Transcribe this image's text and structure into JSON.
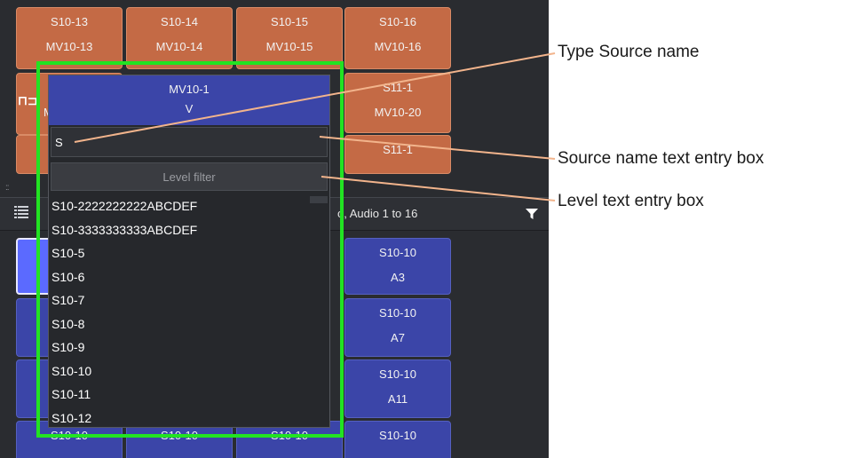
{
  "grid": {
    "top_row": [
      {
        "source": "S10-13",
        "name": "MV10-13"
      },
      {
        "source": "S10-14",
        "name": "MV10-14"
      },
      {
        "source": "S10-15",
        "name": "MV10-15"
      },
      {
        "source": "S10-16",
        "name": "MV10-16"
      }
    ],
    "right_column_top": [
      {
        "source": "S11-1",
        "name": "MV10-20"
      },
      {
        "source": "S11-1",
        "name": ""
      }
    ],
    "partial_left_label": "M",
    "level_bar_text": "o, Audio 1 to 16",
    "lower_right_column": [
      {
        "source": "S10-10",
        "level": "A3"
      },
      {
        "source": "S10-10",
        "level": "A7"
      },
      {
        "source": "S10-10",
        "level": "A11"
      },
      {
        "source": "S10-10",
        "level": ""
      }
    ],
    "bottom_partial_labels": [
      "S10-10",
      "S10-10",
      "S10-10"
    ]
  },
  "popup": {
    "header_line1": "MV10-1",
    "header_line2": "V",
    "source_value": "S",
    "level_placeholder": "Level filter",
    "results": [
      "S10-2222222222ABCDEF",
      "S10-3333333333ABCDEF",
      "S10-5",
      "S10-6",
      "S10-7",
      "S10-8",
      "S10-9",
      "S10-10",
      "S10-11",
      "S10-12"
    ]
  },
  "callouts": {
    "type_source_name": "Type Source name",
    "source_name_box": "Source name text entry box",
    "level_box": "Level text entry box"
  },
  "colors": {
    "highlight": "#22e322",
    "callout_line": "#f2b48c",
    "orange_button": "#c46a45",
    "blue_button": "#3b45a8",
    "selected_button": "#5b6aff"
  },
  "icons": [
    "list-icon",
    "filter-icon",
    "splitter-grip-icon"
  ]
}
